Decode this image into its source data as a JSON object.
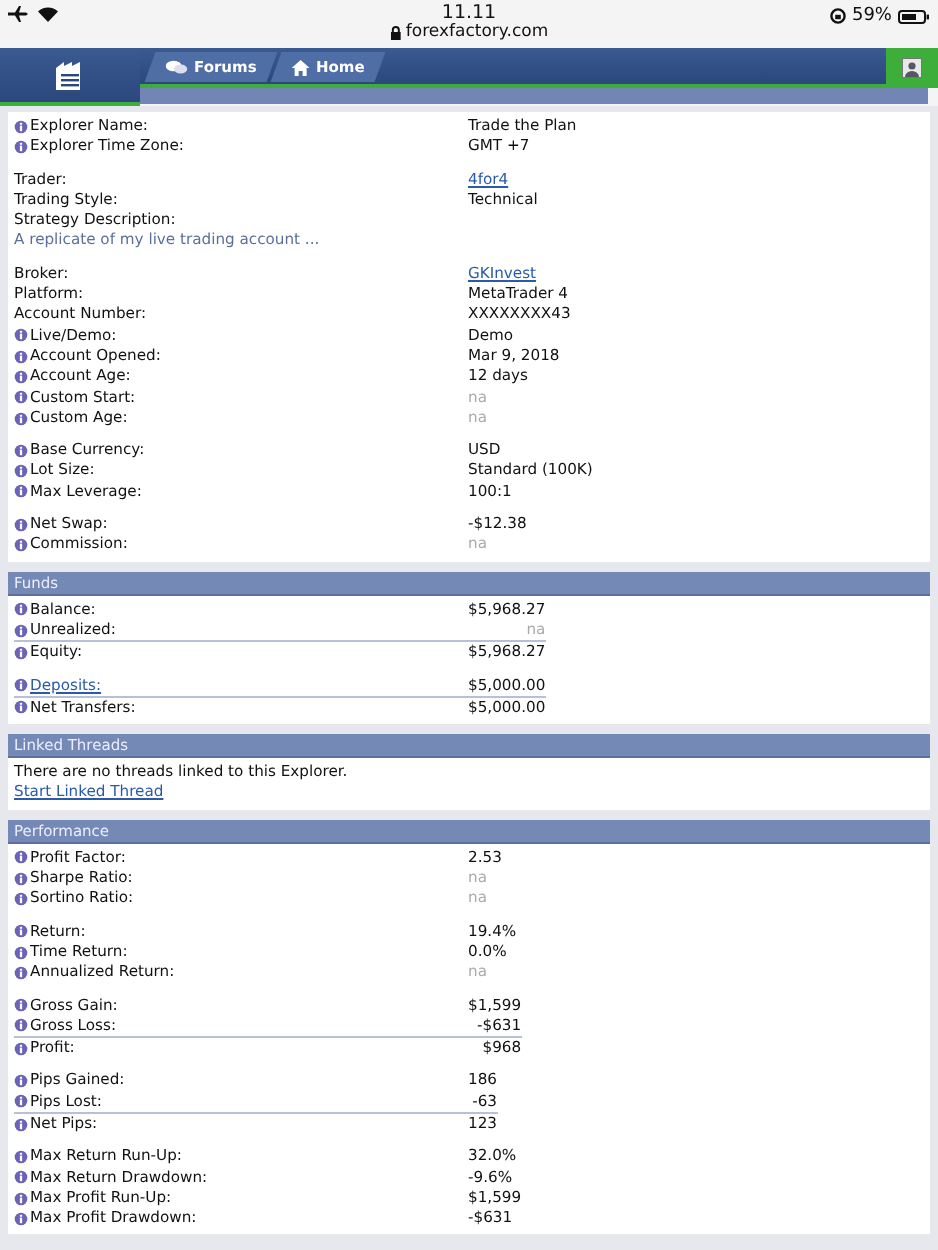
{
  "status_bar": {
    "time": "11.11",
    "url": "forexfactory.com",
    "battery": "59%"
  },
  "nav": {
    "tabs": [
      {
        "label": "Forums",
        "selected": false
      },
      {
        "label": "Home",
        "selected": false
      }
    ]
  },
  "sections": [
    {
      "groups": [
        {
          "kind": "plain",
          "rows": [
            {
              "label": "Explorer Name:",
              "value": "Trade the Plan",
              "info": true,
              "link": false,
              "greyed": false
            },
            {
              "label": "Explorer Time Zone:",
              "value": "GMT +7",
              "info": true,
              "link": false,
              "greyed": false
            }
          ]
        },
        {
          "kind": "plain",
          "rows": [
            {
              "label": "Trader:",
              "value": "4for4",
              "info": false,
              "link": true,
              "greyed": false
            },
            {
              "label": "Trading Style:",
              "value": "Technical",
              "info": false,
              "link": false,
              "greyed": false
            },
            {
              "label": "Strategy Description:",
              "info": false,
              "note": "A replicate of my live trading account ..."
            }
          ]
        },
        {
          "kind": "plain",
          "rows": [
            {
              "label": "Broker:",
              "value": "GKInvest",
              "info": false,
              "link": true,
              "greyed": false
            },
            {
              "label": "Platform:",
              "value": "MetaTrader 4",
              "info": false,
              "link": false,
              "greyed": false
            },
            {
              "label": "Account Number:",
              "value": "XXXXXXXX43",
              "info": false,
              "link": false,
              "greyed": false
            },
            {
              "label": "Live/Demo:",
              "value": "Demo",
              "info": true,
              "link": false,
              "greyed": false
            },
            {
              "label": "Account Opened:",
              "value": "Mar 9, 2018",
              "info": true,
              "link": false,
              "greyed": false
            },
            {
              "label": "Account Age:",
              "value": "12 days",
              "info": true,
              "link": false,
              "greyed": false
            },
            {
              "label": "Custom Start:",
              "value": "na",
              "info": true,
              "link": false,
              "greyed": true
            },
            {
              "label": "Custom Age:",
              "value": "na",
              "info": true,
              "link": false,
              "greyed": true
            }
          ]
        },
        {
          "kind": "plain",
          "rows": [
            {
              "label": "Base Currency:",
              "value": "USD",
              "info": true,
              "link": false,
              "greyed": false
            },
            {
              "label": "Lot Size:",
              "value": "Standard (100K)",
              "info": true,
              "link": false,
              "greyed": false
            },
            {
              "label": "Max Leverage:",
              "value": "100:1",
              "info": true,
              "link": false,
              "greyed": false
            }
          ]
        },
        {
          "kind": "plain",
          "rows": [
            {
              "label": "Net Swap:",
              "value": "-$12.38",
              "info": true,
              "link": false,
              "greyed": false
            },
            {
              "label": "Commission:",
              "value": "na",
              "info": true,
              "link": false,
              "greyed": true
            }
          ]
        }
      ]
    },
    {
      "title": "Funds",
      "groups": [
        {
          "kind": "sum",
          "rows": [
            {
              "label": "Balance:",
              "value": "$5,968.27",
              "info": true,
              "link": false,
              "greyed": false,
              "ruled": false
            },
            {
              "label": "Unrealized:",
              "value": "na",
              "info": true,
              "link": false,
              "greyed": true,
              "ruled": false
            },
            {
              "label": "Equity:",
              "value": "$5,968.27",
              "info": true,
              "link": false,
              "greyed": false,
              "ruled": true
            }
          ]
        },
        {
          "kind": "sum",
          "rows": [
            {
              "label": "Deposits:",
              "value": "$5,000.00",
              "info": true,
              "link": false,
              "greyed": false,
              "label_link": true,
              "ruled": false
            },
            {
              "label": "Net Transfers:",
              "value": "$5,000.00",
              "info": true,
              "link": false,
              "greyed": false,
              "label_link": false,
              "ruled": true
            }
          ]
        }
      ]
    },
    {
      "title": "Linked Threads",
      "text": "There are no threads linked to this Explorer.",
      "link": "Start Linked Thread"
    },
    {
      "title": "Performance",
      "groups": [
        {
          "kind": "plain",
          "rows": [
            {
              "label": "Profit Factor:",
              "value": "2.53",
              "info": true,
              "link": false,
              "greyed": false
            },
            {
              "label": "Sharpe Ratio:",
              "value": "na",
              "info": true,
              "link": false,
              "greyed": true
            },
            {
              "label": "Sortino Ratio:",
              "value": "na",
              "info": true,
              "link": false,
              "greyed": true
            }
          ]
        },
        {
          "kind": "plain",
          "rows": [
            {
              "label": "Return:",
              "value": "19.4%",
              "info": true,
              "link": false,
              "greyed": false
            },
            {
              "label": "Time Return:",
              "value": "0.0%",
              "info": true,
              "link": false,
              "greyed": false
            },
            {
              "label": "Annualized Return:",
              "value": "na",
              "info": true,
              "link": false,
              "greyed": true
            }
          ]
        },
        {
          "kind": "sum",
          "rows": [
            {
              "label": "Gross Gain:",
              "value": "$1,599",
              "info": true,
              "link": false,
              "greyed": false,
              "ruled": false
            },
            {
              "label": "Gross Loss:",
              "value": "-$631",
              "info": true,
              "link": false,
              "greyed": false,
              "ruled": false
            },
            {
              "label": "Profit:",
              "value": "$968",
              "info": true,
              "link": false,
              "greyed": false,
              "ruled": true
            }
          ]
        },
        {
          "kind": "sum",
          "rows": [
            {
              "label": "Pips Gained:",
              "value": "186",
              "info": true,
              "link": false,
              "greyed": false,
              "ruled": false
            },
            {
              "label": "Pips Lost:",
              "value": "-63",
              "info": true,
              "link": false,
              "greyed": false,
              "ruled": false
            },
            {
              "label": "Net Pips:",
              "value": "123",
              "info": true,
              "link": false,
              "greyed": false,
              "ruled": true
            }
          ]
        },
        {
          "kind": "plain",
          "rows": [
            {
              "label": "Max Return Run-Up:",
              "value": "32.0%",
              "info": true,
              "link": false,
              "greyed": false
            },
            {
              "label": "Max Return Drawdown:",
              "value": "-9.6%",
              "info": true,
              "link": false,
              "greyed": false
            },
            {
              "label": "Max Profit Run-Up:",
              "value": "$1,599",
              "info": true,
              "link": false,
              "greyed": false
            },
            {
              "label": "Max Profit Drawdown:",
              "value": "-$631",
              "info": true,
              "link": false,
              "greyed": false
            }
          ]
        }
      ]
    }
  ]
}
